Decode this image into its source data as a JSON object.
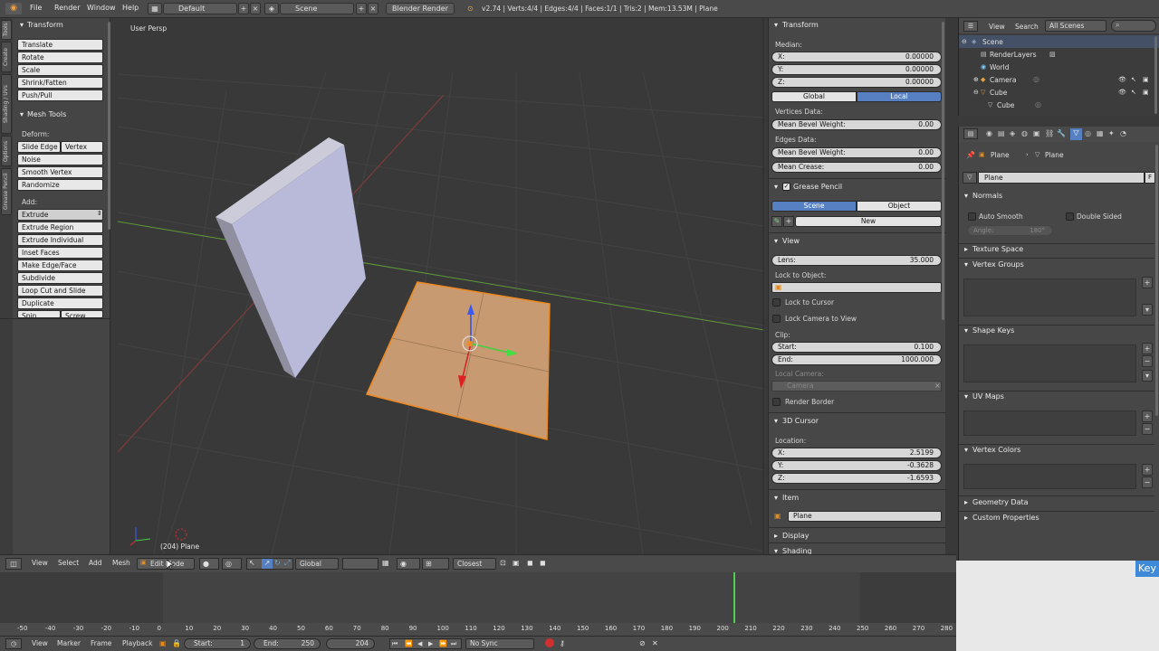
{
  "topbar": {
    "menus": [
      "File",
      "Render",
      "Window",
      "Help"
    ],
    "layout": "Default",
    "scene": "Scene",
    "engine": "Blender Render",
    "stats": "v2.74 | Verts:4/4 | Edges:4/4 | Faces:1/1 | Tris:2 | Mem:13.53M | Plane"
  },
  "toolshelf": {
    "tabs": [
      "Tools",
      "Create",
      "Shading / UVs",
      "Options",
      "Grease Pencil"
    ],
    "transform_title": "Transform",
    "transform_buttons": [
      "Translate",
      "Rotate",
      "Scale",
      "Shrink/Fatten",
      "Push/Pull"
    ],
    "meshtools_title": "Mesh Tools",
    "deform_label": "Deform:",
    "slide_edge": "Slide Edge",
    "vertex": "Vertex",
    "noise": "Noise",
    "smooth_vertex": "Smooth Vertex",
    "randomize": "Randomize",
    "add_label": "Add:",
    "extrude": "Extrude",
    "add_buttons": [
      "Extrude Region",
      "Extrude Individual",
      "Inset Faces",
      "Make Edge/Face",
      "Subdivide",
      "Loop Cut and Slide",
      "Duplicate"
    ],
    "spin": "Spin",
    "screw": "Screw"
  },
  "viewport": {
    "view_label": "User Persp",
    "object_info": "(204) Plane"
  },
  "npanel": {
    "transform_title": "Transform",
    "median_label": "Median:",
    "x_label": "X:",
    "x_value": "0.00000",
    "y_label": "Y:",
    "y_value": "0.00000",
    "z_label": "Z:",
    "z_value": "0.00000",
    "global": "Global",
    "local": "Local",
    "vertices_data": "Vertices Data:",
    "mean_bevel_weight": "Mean Bevel Weight:",
    "v_bevel_value": "0.00",
    "edges_data": "Edges Data:",
    "e_bevel_value": "0.00",
    "mean_crease": "Mean Crease:",
    "crease_value": "0.00",
    "grease_title": "Grease Pencil",
    "scene_tab": "Scene",
    "object_tab": "Object",
    "new_btn": "New",
    "view_title": "View",
    "lens_label": "Lens:",
    "lens_value": "35.000",
    "lock_to_object": "Lock to Object:",
    "lock_to_cursor": "Lock to Cursor",
    "lock_camera": "Lock Camera to View",
    "clip_label": "Clip:",
    "start_label": "Start:",
    "start_value": "0.100",
    "end_label": "End:",
    "end_value": "1000.000",
    "local_camera": "Local Camera:",
    "camera_value": "Camera",
    "render_border": "Render Border",
    "cursor_title": "3D Cursor",
    "location_label": "Location:",
    "cx_value": "2.5199",
    "cy_value": "-0.3628",
    "cz_value": "-1.6593",
    "item_title": "Item",
    "item_name": "Plane",
    "display_title": "Display",
    "shading_title": "Shading"
  },
  "outliner": {
    "view": "View",
    "search": "Search",
    "scenes": "All Scenes",
    "items": [
      "Scene",
      "RenderLayers",
      "World",
      "Camera",
      "Cube",
      "Cube"
    ]
  },
  "props": {
    "breadcrumb_plane1": "Plane",
    "breadcrumb_plane2": "Plane",
    "name_field": "Plane",
    "fake_user": "F",
    "normals": "Normals",
    "auto_smooth": "Auto Smooth",
    "double_sided": "Double Sided",
    "angle": "Angle:",
    "angle_value": "180°",
    "texture_space": "Texture Space",
    "vertex_groups": "Vertex Groups",
    "shape_keys": "Shape Keys",
    "uv_maps": "UV Maps",
    "vertex_colors": "Vertex Colors",
    "geometry_data": "Geometry Data",
    "custom_properties": "Custom Properties"
  },
  "vheader": {
    "view": "View",
    "select": "Select",
    "add": "Add",
    "mesh": "Mesh",
    "mode": "Edit Mode",
    "orientation": "Global",
    "snap": "Closest"
  },
  "timeline": {
    "ticks": [
      "-50",
      "-40",
      "-30",
      "-20",
      "-10",
      "0",
      "10",
      "20",
      "30",
      "40",
      "50",
      "60",
      "70",
      "80",
      "90",
      "100",
      "110",
      "120",
      "130",
      "140",
      "150",
      "160",
      "170",
      "180",
      "190",
      "200",
      "210",
      "220",
      "230",
      "240",
      "250",
      "260",
      "270",
      "280"
    ],
    "view": "View",
    "marker": "Marker",
    "frame": "Frame",
    "playback": "Playback",
    "start_label": "Start:",
    "start_value": "1",
    "end_label": "End:",
    "end_value": "250",
    "current_frame": "204",
    "sync": "No Sync"
  },
  "key_badge": "Key"
}
